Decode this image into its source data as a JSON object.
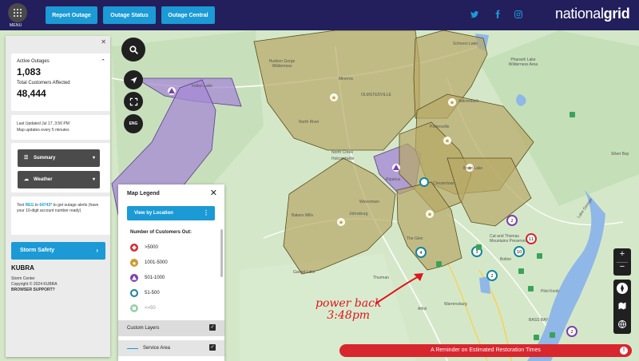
{
  "header": {
    "menu_label": "MENU",
    "nav": [
      "Report Outage",
      "Outage Status",
      "Outage Central"
    ],
    "social_icons": [
      "twitter-icon",
      "facebook-icon",
      "instagram-icon"
    ],
    "brand": {
      "part1": "national",
      "part2": "grid"
    },
    "colors": {
      "bar": "#231f5c",
      "accent": "#1b9ad6"
    }
  },
  "left_panel": {
    "active_outages_label": "Active Outages",
    "active_outages_value": "1,083",
    "total_customers_label": "Total Customers Affected",
    "total_customers_value": "48,444",
    "last_updated": "Last Updated  Jul 17, 3:56 PM",
    "update_freq": "Map updates every 5 minutes",
    "dropdowns": [
      "Summary",
      "Weather"
    ],
    "text_alert": {
      "prefix": "Text ",
      "keyword": "REG",
      "mid": " to ",
      "number": "64743*",
      "suffix": " to get outage alerts (have your 10-digit account number ready)"
    },
    "storm_safety": "Storm Safety",
    "kubra_logo": "KUBRA",
    "kubra_lines": [
      "Storm Center",
      "Copyright © 2024 KUBRA",
      "BROWSER SUPPORT?"
    ]
  },
  "map_controls": {
    "lang": "ENG",
    "zoom_in": "+",
    "zoom_out": "−"
  },
  "legend": {
    "title": "Map Legend",
    "view_by_location": "View by Location",
    "subtitle": "Number of Customers Out:",
    "items": [
      {
        "label": ">5000",
        "color": "#d8262e",
        "shape": "diamond"
      },
      {
        "label": "1001-5000",
        "color": "#c99a2e",
        "shape": "star"
      },
      {
        "label": "501-1000",
        "color": "#7e3fb1",
        "shape": "triangle"
      },
      {
        "label": "51-500",
        "color": "#16839c",
        "shape": "circle"
      },
      {
        "label": "<=50",
        "color": "#3aa35a",
        "shape": "square"
      }
    ],
    "custom_layers": "Custom Layers",
    "service_area": "Service Area"
  },
  "map_labels": [
    "Schroon Lake",
    "Pharaoh Lake Wilderness Area",
    "Hudson Gorge Wilderness",
    "Indian Lake",
    "Minerva",
    "OLMSTEDVILLE",
    "Adirondack",
    "North River",
    "Pottersville",
    "Silver Bay",
    "North Creek",
    "Holcombville",
    "Brant Lake",
    "Riparius",
    "Chestertown",
    "Wevertown",
    "Johnsburg",
    "Bakers Mills",
    "The Glen",
    "Cat and Thomas Mountains Preserves",
    "Bolton",
    "Garnet Lake",
    "Thurman",
    "Pilot Knob",
    "Athol",
    "Warrensburg",
    "Lake George",
    "BASS BAY"
  ],
  "reminder": "A Reminder on Estimated Restoration Times",
  "annotation": {
    "line1": "power back",
    "line2": "3:48pm"
  }
}
